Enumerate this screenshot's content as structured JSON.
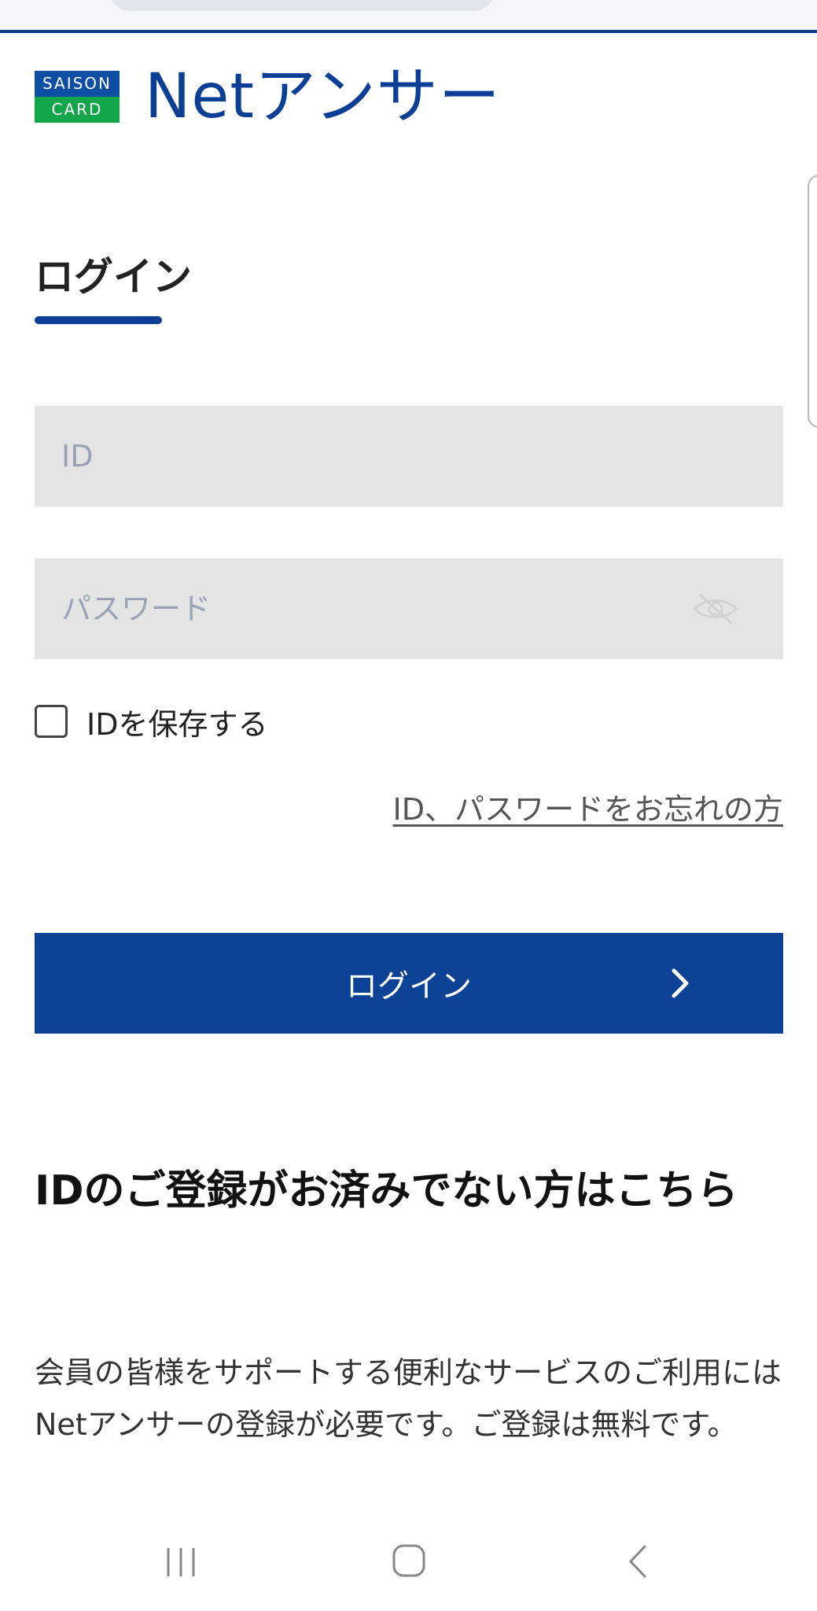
{
  "logo": {
    "top_text": "SAISON",
    "bottom_text": "CARD"
  },
  "brand": "Netアンサー",
  "login_title": "ログイン",
  "form": {
    "id_placeholder": "ID",
    "password_placeholder": "パスワード",
    "save_id_label": "IDを保存する",
    "save_id_checked": false,
    "forgot_link": "ID、パスワードをお忘れの方",
    "login_button": "ログイン"
  },
  "registration": {
    "heading": "IDのご登録がお済みでない方はこちら",
    "body": "会員の皆様をサポートする便利なサービスのご利用にはNetアンサーの登録が必要です。ご登録は無料です。"
  },
  "colors": {
    "brand_blue": "#0b3f96",
    "button_blue": "#0b4296",
    "logo_green": "#12a54a",
    "field_bg": "#e4e4e4"
  },
  "icons": [
    "eye-slash-icon",
    "chevron-right-icon",
    "recents-icon",
    "home-icon",
    "back-icon"
  ]
}
